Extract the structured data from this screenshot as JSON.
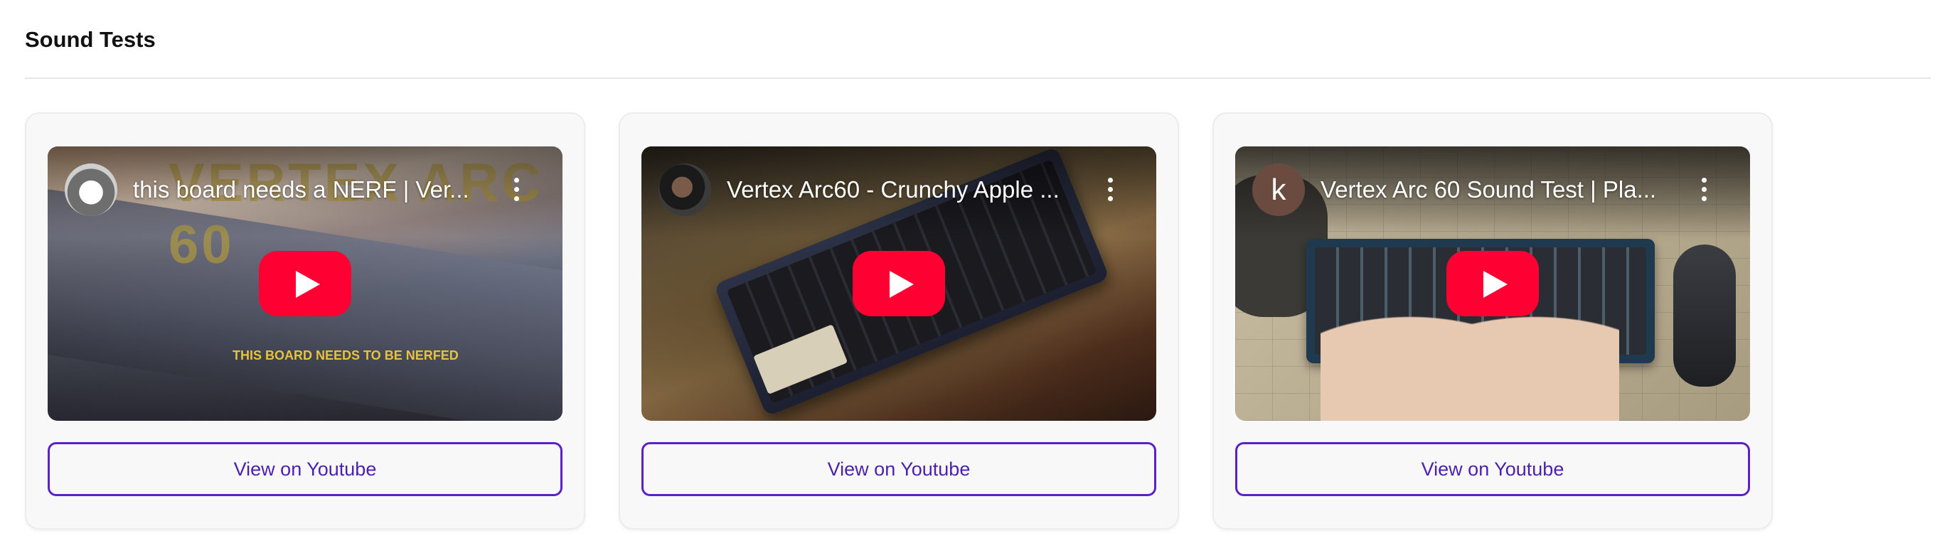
{
  "section": {
    "title": "Sound Tests"
  },
  "videos": [
    {
      "title": "this board needs a NERF | Ver...",
      "thumbnail_text_large": "VERTEX ARC 60",
      "thumbnail_text_small": "THIS BOARD NEEDS TO BE NERFED",
      "button_label": "View on Youtube"
    },
    {
      "title": "Vertex Arc60 - Crunchy Apple ...",
      "button_label": "View on Youtube"
    },
    {
      "title": "Vertex Arc 60 Sound Test | Pla...",
      "avatar_letter": "k",
      "button_label": "View on Youtube"
    }
  ],
  "icons": {
    "play": "youtube-play-icon",
    "menu": "more-vertical-icon"
  },
  "colors": {
    "accent": "#5b21c7",
    "play_button": "#ff0033"
  }
}
